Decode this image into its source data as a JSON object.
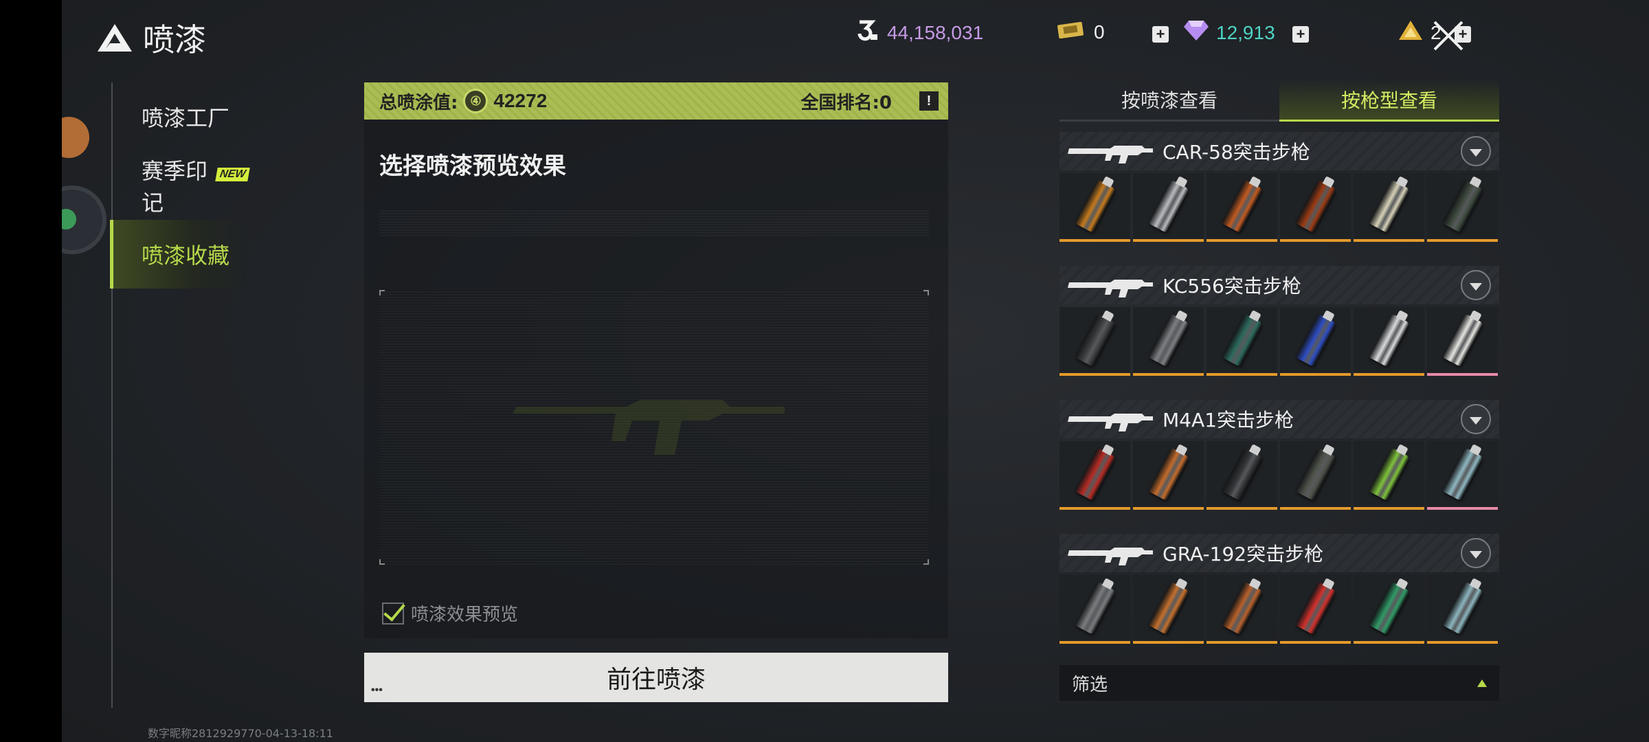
{
  "header": {
    "title": "喷漆",
    "currency_primary": "44,158,031",
    "tickets": "0",
    "diamonds": "12,913",
    "vouchers": "2"
  },
  "sidebar": {
    "items": [
      {
        "label": "喷漆工厂"
      },
      {
        "label": "赛季印记",
        "badge": "NEW"
      },
      {
        "label": "喷漆收藏"
      }
    ]
  },
  "stats": {
    "total_label": "总喷涂值:",
    "total_value": "42272",
    "rank_label": "全国排名:0",
    "info": "!"
  },
  "preview": {
    "title": "选择喷漆预览效果",
    "checkbox_label": "喷漆效果预览"
  },
  "go_button": {
    "label": "前往喷漆",
    "dots": "•••"
  },
  "tabs": [
    {
      "label": "按喷漆查看"
    },
    {
      "label": "按枪型查看"
    }
  ],
  "weapons": [
    {
      "name": "CAR-58突击步枪",
      "cans": [
        {
          "color": "#c57a1c",
          "rarity": "gold"
        },
        {
          "color": "#b9bcbf",
          "rarity": "gold"
        },
        {
          "color": "#c2591f",
          "rarity": "gold"
        },
        {
          "color": "#9a3a12",
          "rarity": "gold"
        },
        {
          "color": "#d7d2b8",
          "rarity": "gold"
        },
        {
          "color": "#3e4a3e",
          "rarity": "gold"
        }
      ]
    },
    {
      "name": "KC556突击步枪",
      "cans": [
        {
          "color": "#3b3d3f",
          "rarity": "gold"
        },
        {
          "color": "#7d8083",
          "rarity": "gold"
        },
        {
          "color": "#2c6a5e",
          "rarity": "gold"
        },
        {
          "color": "#2e4dc4",
          "rarity": "gold"
        },
        {
          "color": "#d9dadb",
          "rarity": "gold"
        },
        {
          "color": "#e5e5e0",
          "rarity": "pink"
        }
      ]
    },
    {
      "name": "M4A1突击步枪",
      "cans": [
        {
          "color": "#b52a22",
          "rarity": "gold"
        },
        {
          "color": "#c46b2a",
          "rarity": "gold"
        },
        {
          "color": "#333638",
          "rarity": "gold"
        },
        {
          "color": "#4c5148",
          "rarity": "gold"
        },
        {
          "color": "#7ec23a",
          "rarity": "gold"
        },
        {
          "color": "#8fb8c2",
          "rarity": "pink"
        }
      ]
    },
    {
      "name": "GRA-192突击步枪",
      "cans": [
        {
          "color": "#7a7d7f",
          "rarity": "gold"
        },
        {
          "color": "#c46f2c",
          "rarity": "gold"
        },
        {
          "color": "#b8602a",
          "rarity": "gold"
        },
        {
          "color": "#d2302b",
          "rarity": "gold"
        },
        {
          "color": "#2f9a66",
          "rarity": "gold"
        },
        {
          "color": "#8cb6bf",
          "rarity": "gold"
        }
      ]
    }
  ],
  "filter": {
    "label": "筛选"
  },
  "footer": {
    "id_text": "数字昵称2812929770-04-13-18:11"
  },
  "colors": {
    "accent": "#b6d94a",
    "gold_rarity": "#e39a2b",
    "pink_rarity": "#e88aa9",
    "diamond": "#4fd3c4",
    "currency": "#c79ae6"
  }
}
